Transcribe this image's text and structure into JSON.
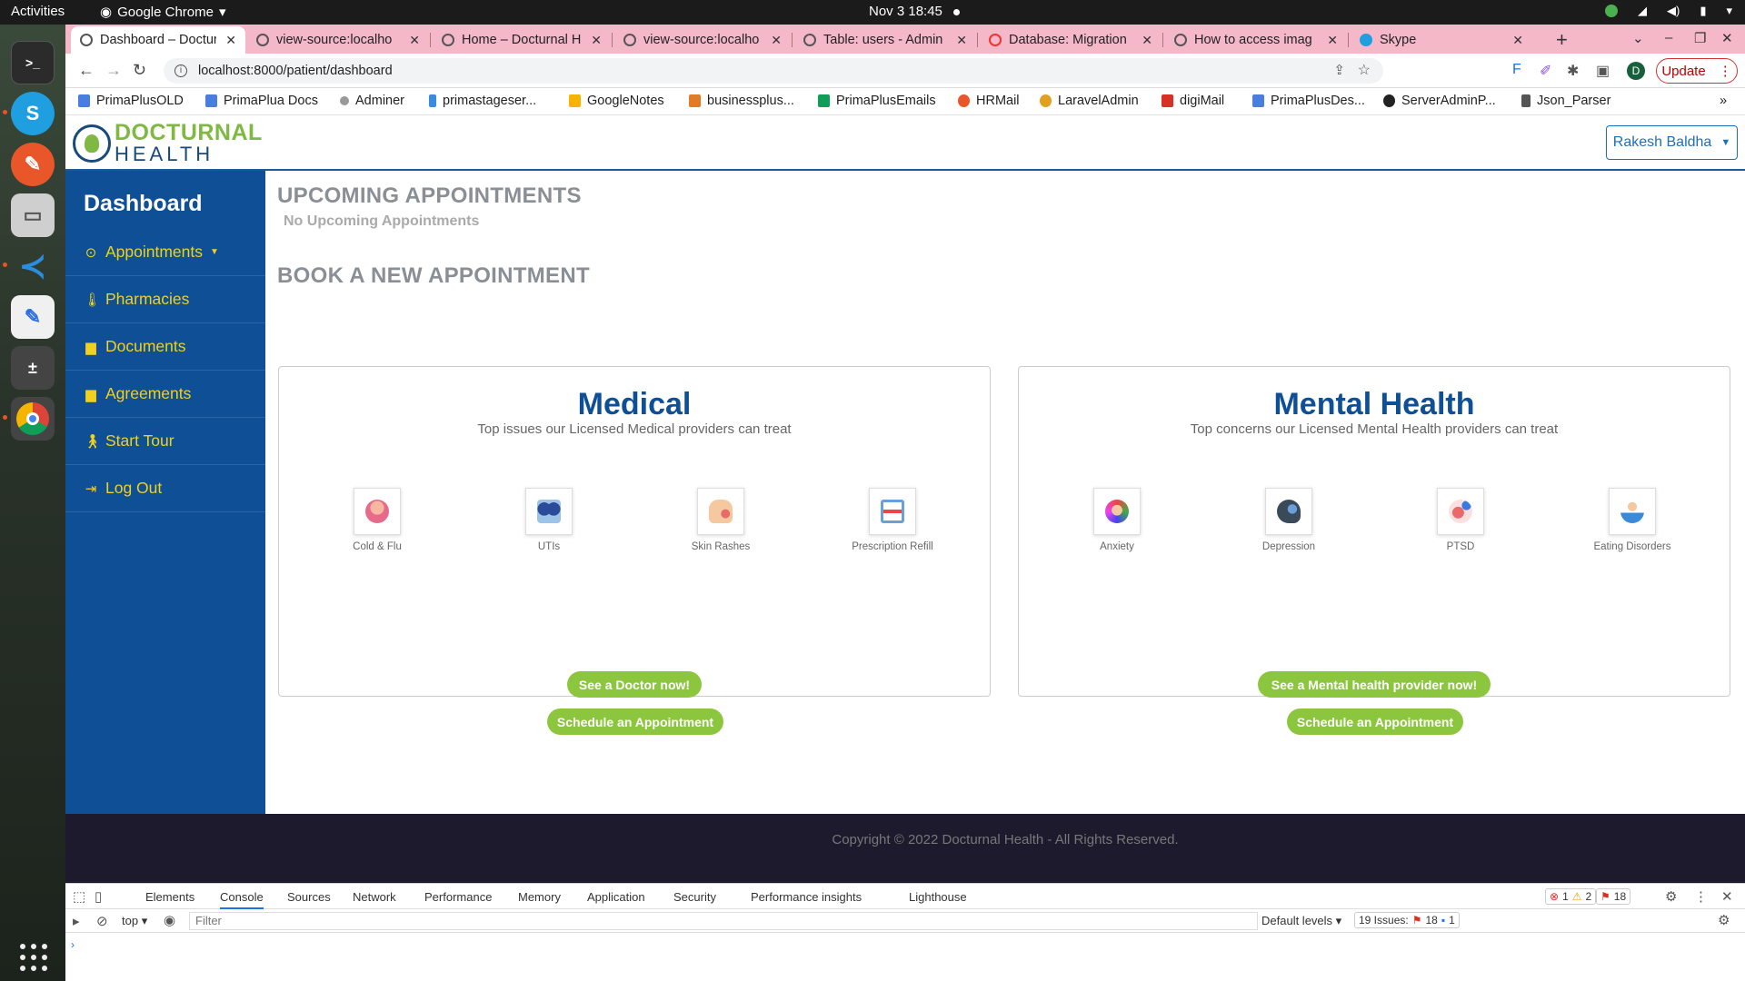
{
  "os": {
    "activities": "Activities",
    "app_name": "Google Chrome",
    "clock": "Nov 3  18:45"
  },
  "browser": {
    "tabs": [
      {
        "title": "Dashboard – Doctur"
      },
      {
        "title": "view-source:localho"
      },
      {
        "title": "Home – Docturnal H"
      },
      {
        "title": "view-source:localho"
      },
      {
        "title": "Table: users - Admin"
      },
      {
        "title": "Database: Migration"
      },
      {
        "title": "How to access imag"
      },
      {
        "title": "Skype"
      }
    ],
    "url": "localhost:8000/patient/dashboard",
    "update_label": "Update",
    "profile_initial": "D",
    "bookmarks": [
      "PrimaPlusOLD",
      "PrimaPlua Docs",
      "Adminer",
      "primastageser...",
      "GoogleNotes",
      "businessplus...",
      "PrimaPlusEmails",
      "HRMail",
      "LaravelAdmin",
      "digiMail",
      "PrimaPlusDes...",
      "ServerAdminP...",
      "Json_Parser"
    ]
  },
  "site": {
    "logo_line1": "DOCTURNAL",
    "logo_line2": "HEALTH",
    "user_name": "Rakesh Baldha",
    "sidebar": {
      "title": "Dashboard",
      "items": [
        {
          "label": "Appointments",
          "icon": "clock-icon"
        },
        {
          "label": "Pharmacies",
          "icon": "thermometer-icon"
        },
        {
          "label": "Documents",
          "icon": "file-icon"
        },
        {
          "label": "Agreements",
          "icon": "file-text-icon"
        },
        {
          "label": "Start Tour",
          "icon": "walking-icon"
        },
        {
          "label": "Log Out",
          "icon": "logout-icon"
        }
      ]
    },
    "upcoming": {
      "heading": "UPCOMING APPOINTMENTS",
      "empty": "No Upcoming Appointments"
    },
    "book_heading": "BOOK A NEW APPOINTMENT",
    "medical": {
      "title": "Medical",
      "subtitle": "Top issues our Licensed Medical providers can treat",
      "items": [
        "Cold & Flu",
        "UTIs",
        "Skin Rashes",
        "Prescription Refill"
      ],
      "primary_button": "See a Doctor now!",
      "schedule_button": "Schedule an Appointment"
    },
    "mental": {
      "title": "Mental Health",
      "subtitle": "Top concerns our Licensed Mental Health providers can treat",
      "items": [
        "Anxiety",
        "Depression",
        "PTSD",
        "Eating Disorders"
      ],
      "primary_button": "See a Mental health provider now!",
      "schedule_button": "Schedule an Appointment"
    },
    "footer": "Copyright © 2022 Docturnal Health - All Rights Reserved."
  },
  "devtools": {
    "tabs": [
      "Elements",
      "Console",
      "Sources",
      "Network",
      "Performance",
      "Memory",
      "Application",
      "Security",
      "Performance insights",
      "Lighthouse"
    ],
    "errors": "1",
    "warnings": "2",
    "issues_badge": "18",
    "context": "top",
    "filter_placeholder": "Filter",
    "levels": "Default levels",
    "issues_label": "19 Issues:",
    "issues_errors": "18",
    "issues_info": "1"
  },
  "colors": {
    "brand_blue": "#0e4f95",
    "brand_green": "#8cc63f",
    "sidebar_text": "#f0d020",
    "tab_strip": "#f4b8c8"
  }
}
